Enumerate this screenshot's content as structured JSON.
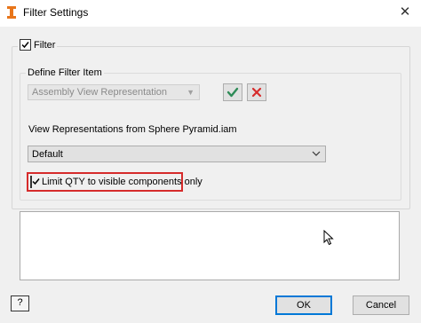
{
  "window": {
    "title": "Filter Settings",
    "close_glyph": "✕",
    "app_icon": "inventor-app-icon"
  },
  "filter": {
    "label": "Filter",
    "checked": true
  },
  "define_filter": {
    "legend": "Define Filter Item",
    "filter_type_value": "Assembly View Representation",
    "filter_type_disabled": true,
    "accept_icon": "checkmark-icon",
    "reject_icon": "x-icon",
    "accent_green": "#2e8b57",
    "accent_red": "#d62b2b"
  },
  "view_representations": {
    "label": "View Representations from Sphere Pyramid.iam",
    "selected": "Default"
  },
  "limit_qty": {
    "label": "Limit QTY to visible components only",
    "checked": true,
    "highlight_color": "#d62b2b"
  },
  "footer": {
    "help_label": "?",
    "ok_label": "OK",
    "cancel_label": "Cancel"
  }
}
